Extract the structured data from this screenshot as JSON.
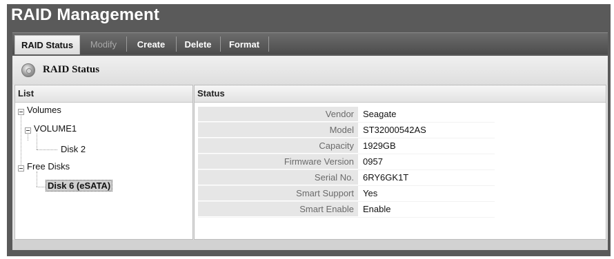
{
  "app": {
    "title": "RAID Management"
  },
  "tabs": [
    {
      "label": "RAID Status",
      "state": "active"
    },
    {
      "label": "Modify",
      "state": "disabled"
    },
    {
      "label": "Create",
      "state": "normal"
    },
    {
      "label": "Delete",
      "state": "normal"
    },
    {
      "label": "Format",
      "state": "normal"
    }
  ],
  "panel": {
    "title": "RAID Status",
    "icon": "disk-icon"
  },
  "list": {
    "header": "List",
    "tree": {
      "volumes": {
        "label": "Volumes",
        "expanded": true
      },
      "volume1": {
        "label": "VOLUME1",
        "expanded": true
      },
      "disk2": {
        "label": "Disk 2"
      },
      "free_disks": {
        "label": "Free Disks",
        "expanded": true
      },
      "disk6": {
        "label": "Disk 6 (eSATA)",
        "selected": true
      }
    }
  },
  "status": {
    "header": "Status",
    "rows": [
      {
        "label": "Vendor",
        "value": "Seagate"
      },
      {
        "label": "Model",
        "value": "ST32000542AS"
      },
      {
        "label": "Capacity",
        "value": "1929GB"
      },
      {
        "label": "Firmware Version",
        "value": "0957"
      },
      {
        "label": "Serial No.",
        "value": "6RY6GK1T"
      },
      {
        "label": "Smart Support",
        "value": "Yes"
      },
      {
        "label": "Smart Enable",
        "value": "Enable"
      }
    ]
  },
  "colors": {
    "frame": "#5a5a5a",
    "panel": "#e3e3e3",
    "label_bg": "#e6e6e6"
  }
}
